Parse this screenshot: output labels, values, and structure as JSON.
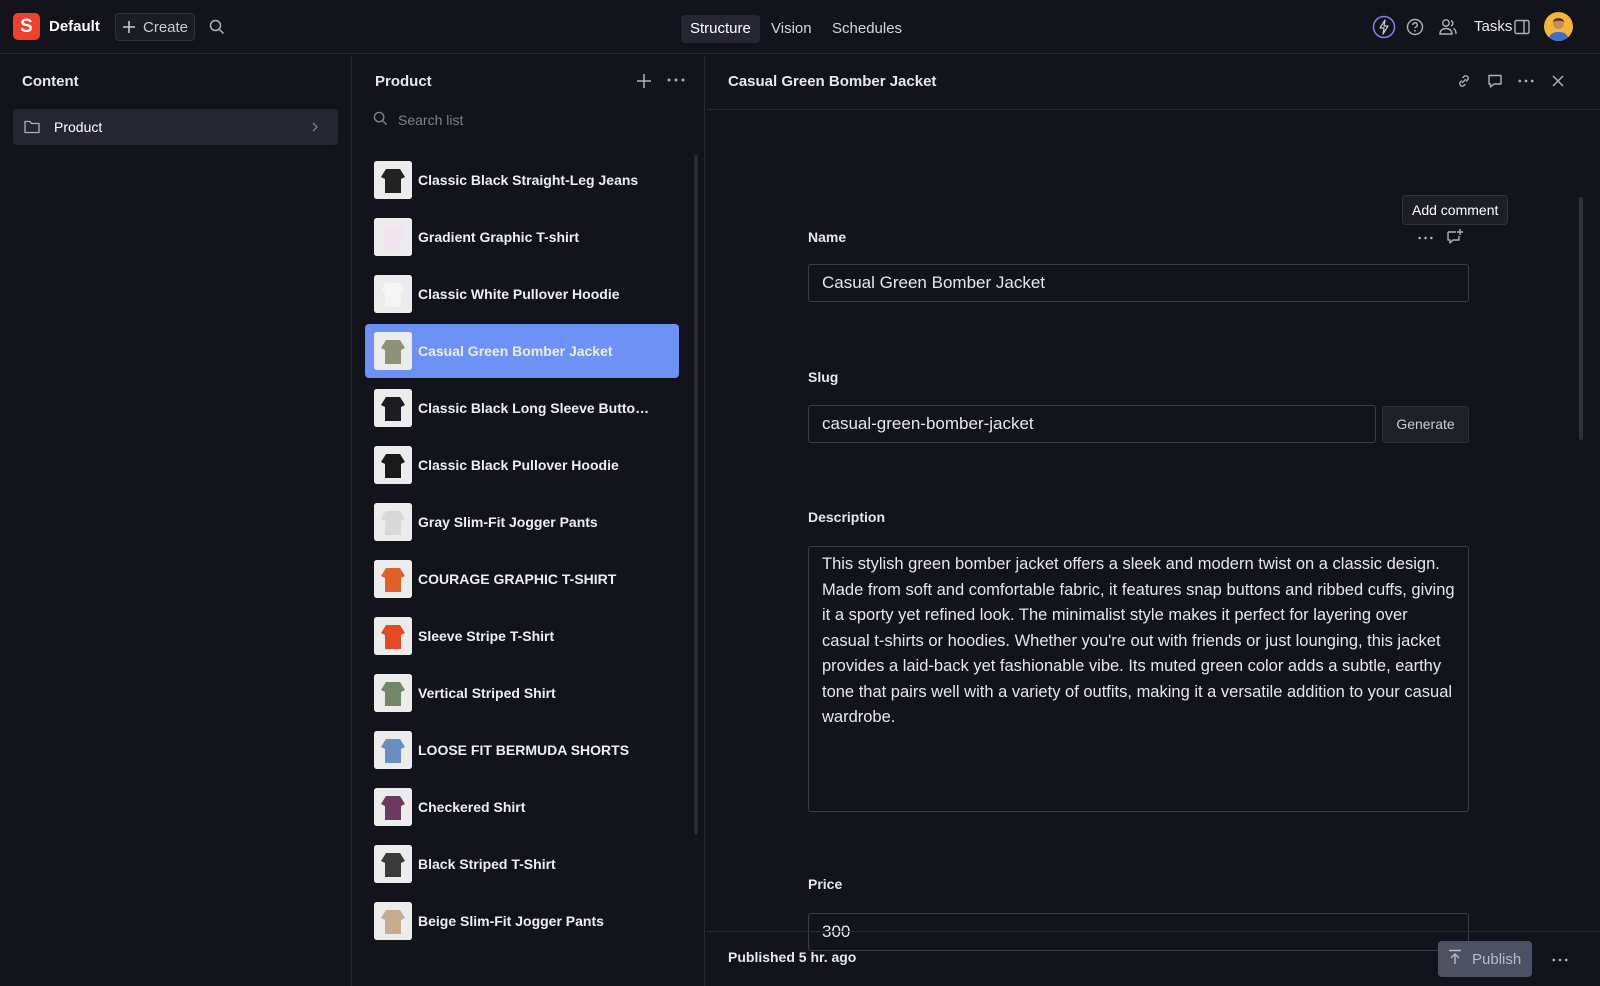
{
  "topbar": {
    "logo_letter": "S",
    "workspace": "Default",
    "create_label": "Create",
    "tabs": [
      {
        "label": "Structure",
        "active": true
      },
      {
        "label": "Vision",
        "active": false
      },
      {
        "label": "Schedules",
        "active": false
      }
    ],
    "tasks_label": "Tasks",
    "icons": [
      "search-icon",
      "bolt-icon",
      "help-icon",
      "users-icon",
      "panel-icon"
    ]
  },
  "content_pane": {
    "title": "Content",
    "items": [
      {
        "label": "Product",
        "icon": "folder-icon"
      }
    ]
  },
  "list_pane": {
    "title": "Product",
    "search_placeholder": "Search list",
    "items": [
      {
        "label": "Classic Black Straight-Leg Jeans",
        "thumb_color": "#222222",
        "selected": false
      },
      {
        "label": "Gradient Graphic T-shirt",
        "thumb_color": "#f1e4ee",
        "selected": false
      },
      {
        "label": "Classic White Pullover Hoodie",
        "thumb_color": "#f5f5f5",
        "selected": false
      },
      {
        "label": "Casual Green Bomber Jacket",
        "thumb_color": "#8c9379",
        "selected": true
      },
      {
        "label": "Classic Black Long Sleeve Button-...",
        "thumb_color": "#1c1c22",
        "selected": false
      },
      {
        "label": "Classic Black Pullover Hoodie",
        "thumb_color": "#1a1a1a",
        "selected": false
      },
      {
        "label": "Gray Slim-Fit Jogger Pants",
        "thumb_color": "#d8d8d8",
        "selected": false
      },
      {
        "label": "COURAGE GRAPHIC T-SHIRT",
        "thumb_color": "#e0602c",
        "selected": false
      },
      {
        "label": "Sleeve Stripe T-Shirt",
        "thumb_color": "#e34a22",
        "selected": false
      },
      {
        "label": "Vertical Striped Shirt",
        "thumb_color": "#718768",
        "selected": false
      },
      {
        "label": "LOOSE FIT BERMUDA SHORTS",
        "thumb_color": "#6a8fbe",
        "selected": false
      },
      {
        "label": "Checkered Shirt",
        "thumb_color": "#6b3a5e",
        "selected": false
      },
      {
        "label": "Black Striped T-Shirt",
        "thumb_color": "#3a3a3a",
        "selected": false
      },
      {
        "label": "Beige Slim-Fit Jogger Pants",
        "thumb_color": "#c8ab8e",
        "selected": false
      }
    ]
  },
  "document": {
    "title": "Casual Green Bomber Jacket",
    "tooltip": "Add comment",
    "fields": {
      "name_label": "Name",
      "name_value": "Casual Green Bomber Jacket",
      "slug_label": "Slug",
      "slug_value": "casual-green-bomber-jacket",
      "generate_label": "Generate",
      "description_label": "Description",
      "description_value": "This stylish green bomber jacket offers a sleek and modern twist on a classic design. Made from soft and comfortable fabric, it features snap buttons and ribbed cuffs, giving it a sporty yet refined look. The minimalist style makes it perfect for layering over casual t-shirts or hoodies. Whether you're out with friends or just lounging, this jacket provides a laid-back yet fashionable vibe. Its muted green color adds a subtle, earthy tone that pairs well with a variety of outfits, making it a versatile addition to your casual wardrobe.",
      "price_label": "Price",
      "price_value": "300"
    },
    "footer": {
      "status": "Published 5 hr. ago",
      "publish_label": "Publish"
    }
  },
  "colors": {
    "background": "#13141b",
    "accent_selected": "#6e91f5",
    "logo": "#f03e2f",
    "bolt_ring": "#8a7cf0"
  }
}
